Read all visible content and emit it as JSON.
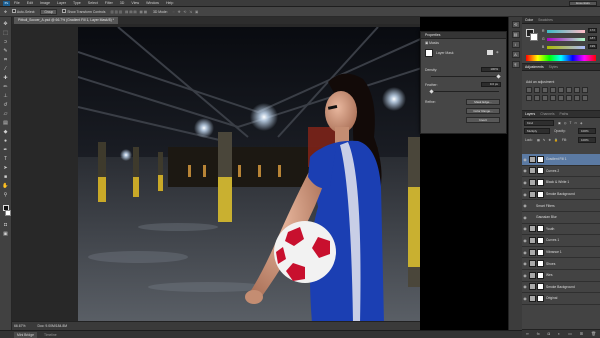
{
  "menubar": {
    "logo": "Ps",
    "items": [
      "File",
      "Edit",
      "Image",
      "Layer",
      "Type",
      "Select",
      "Filter",
      "3D",
      "View",
      "Window",
      "Help"
    ],
    "workspace": "Essentials"
  },
  "options": {
    "auto_select_label": "Auto-Select:",
    "auto_select_value": "Group",
    "transform_label": "Show Transform Controls",
    "mode_label": "3D Mode:"
  },
  "document": {
    "tab_title": "Pitbull_Soccer_A.psd @ 66.7% (Gradient Fill 1, Layer Mask/8) *"
  },
  "status": {
    "zoom": "66.67%",
    "doc_size": "Doc: 9.00M/184.8M"
  },
  "minibridge": {
    "tabs": [
      "Mini Bridge",
      "Timeline"
    ]
  },
  "properties": {
    "title": "Properties",
    "masks_label": "Masks",
    "layer_mask_label": "Layer Mask",
    "density_label": "Density:",
    "density_value": "100%",
    "feather_label": "Feather:",
    "feather_value": "0.0 px",
    "refine_label": "Refine:",
    "mask_edge_btn": "Mask Edge...",
    "color_range_btn": "Color Range...",
    "invert_btn": "Invert"
  },
  "color_panel": {
    "tabs": [
      "Color",
      "Swatches"
    ],
    "r": "172",
    "g": "187",
    "b": "199",
    "r_label": "R",
    "g_label": "G",
    "b_label": "B"
  },
  "adjustments": {
    "tabs": [
      "Adjustments",
      "Styles"
    ],
    "title": "Add an adjustment"
  },
  "layers_panel": {
    "tabs": [
      "Layers",
      "Channels",
      "Paths"
    ],
    "kind_label": "Kind",
    "blend_mode": "Multiply",
    "opacity_label": "Opacity:",
    "opacity_value": "100%",
    "lock_label": "Lock:",
    "fill_label": "Fill:",
    "fill_value": "100%",
    "layers": [
      {
        "name": "Gradient Fill 1",
        "selected": true,
        "indent": false
      },
      {
        "name": "Curves 2",
        "selected": false,
        "indent": false
      },
      {
        "name": "Black & White 1",
        "selected": false,
        "indent": false
      },
      {
        "name": "Smoke Background",
        "selected": false,
        "indent": false
      },
      {
        "name": "Smart Filters",
        "selected": false,
        "indent": true
      },
      {
        "name": "Gaussian Blur",
        "selected": false,
        "indent": true
      },
      {
        "name": "Youth",
        "selected": false,
        "indent": false
      },
      {
        "name": "Curves 1",
        "selected": false,
        "indent": false
      },
      {
        "name": "Vibrance 1",
        "selected": false,
        "indent": false
      },
      {
        "name": "Shoes",
        "selected": false,
        "indent": false
      },
      {
        "name": "Wes",
        "selected": false,
        "indent": false
      },
      {
        "name": "Smoke Background",
        "selected": false,
        "indent": false
      },
      {
        "name": "Original",
        "selected": false,
        "indent": false
      }
    ]
  },
  "colors": {
    "accent_selected": "#5b7aa3",
    "panel_bg": "#434343",
    "jersey_blue": "#1b3fb3",
    "ball_red": "#c8102e"
  }
}
